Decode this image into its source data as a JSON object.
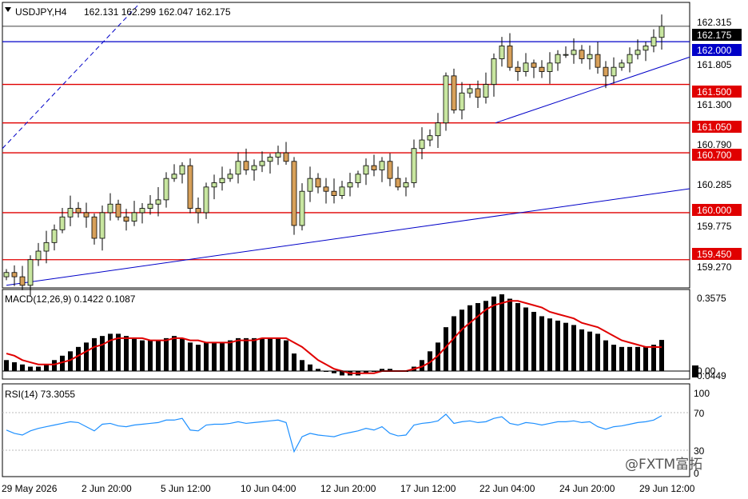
{
  "header": {
    "symbol": "USDJPY,H4",
    "ohlc": "162.131 162.299 162.047 162.175"
  },
  "colors": {
    "background": "#ffffff",
    "bull_body": "#c8e6a0",
    "bear_body": "#d7a05a",
    "wick": "#000000",
    "level_line": "#e00000",
    "level_tag": "#e00000",
    "trend_line": "#0000c8",
    "current_tag": "#000000",
    "macd_hist": "#000000",
    "macd_signal": "#e00000",
    "rsi_line": "#1e90ff"
  },
  "price_axis": {
    "ticks": [
      "162.315",
      "161.805",
      "161.300",
      "160.790",
      "160.285",
      "159.775",
      "159.270"
    ]
  },
  "level_tags": {
    "current": "162.175",
    "blue": "162.000",
    "r1": "161.500",
    "r2": "161.050",
    "r3": "160.700",
    "r4": "160.000",
    "r5": "159.450"
  },
  "macd": {
    "label": "MACD(12,26,9) 0.1422 0.1087",
    "scale_top": "0.3575",
    "scale_zero": "0.00",
    "scale_bottom": "-0.0449"
  },
  "rsi": {
    "label": "RSI(14) 73.3055",
    "levels": [
      "100",
      "70",
      "30",
      "0"
    ]
  },
  "time_axis": {
    "labels": [
      "29 May 2026",
      "2 Jun 20:00",
      "5 Jun 12:00",
      "10 Jun 04:00",
      "12 Jun 20:00",
      "17 Jun 12:00",
      "22 Jun 04:00",
      "24 Jun 20:00",
      "29 Jun 12:00"
    ]
  },
  "watermark": "@FXTM富拓",
  "chart_data": [
    {
      "type": "candlestick",
      "title": "USDJPY,H4",
      "ylim": [
        159.12,
        162.45
      ],
      "horizontal_levels": [
        162.0,
        161.5,
        161.05,
        160.7,
        160.0,
        159.45
      ],
      "closes": [
        159.3,
        159.25,
        159.15,
        159.45,
        159.55,
        159.65,
        159.8,
        159.95,
        160.05,
        160.0,
        159.95,
        159.7,
        160.0,
        160.1,
        159.95,
        159.9,
        160.0,
        160.05,
        160.1,
        160.15,
        160.4,
        160.45,
        160.55,
        160.05,
        160.0,
        160.3,
        160.35,
        160.4,
        160.45,
        160.6,
        160.5,
        160.55,
        160.6,
        160.65,
        160.7,
        160.6,
        159.85,
        160.25,
        160.4,
        160.3,
        160.25,
        160.2,
        160.3,
        160.35,
        160.45,
        160.55,
        160.5,
        160.6,
        160.4,
        160.3,
        160.35,
        160.75,
        160.85,
        160.9,
        161.05,
        161.6,
        161.2,
        161.4,
        161.45,
        161.35,
        161.5,
        161.8,
        161.95,
        161.7,
        161.65,
        161.75,
        161.7,
        161.65,
        161.75,
        161.85,
        161.85,
        161.9,
        161.8,
        161.85,
        161.7,
        161.6,
        161.7,
        161.75,
        161.85,
        161.9,
        161.95,
        162.05,
        162.18
      ]
    },
    {
      "type": "bar",
      "title": "MACD(12,26,9) 0.1422 0.1087",
      "series": [
        {
          "name": "MACD",
          "values": [
            0.05,
            0.04,
            0.03,
            0.02,
            0.02,
            0.03,
            0.05,
            0.07,
            0.09,
            0.11,
            0.13,
            0.15,
            0.16,
            0.17,
            0.17,
            0.16,
            0.15,
            0.14,
            0.14,
            0.14,
            0.15,
            0.16,
            0.15,
            0.13,
            0.12,
            0.13,
            0.13,
            0.13,
            0.14,
            0.15,
            0.15,
            0.15,
            0.15,
            0.15,
            0.15,
            0.14,
            0.08,
            0.05,
            0.03,
            0.01,
            0.0,
            -0.01,
            -0.02,
            -0.02,
            -0.02,
            -0.01,
            0.0,
            0.01,
            0.01,
            0.0,
            0.0,
            0.02,
            0.05,
            0.09,
            0.13,
            0.2,
            0.25,
            0.28,
            0.3,
            0.31,
            0.32,
            0.34,
            0.35,
            0.33,
            0.31,
            0.29,
            0.27,
            0.25,
            0.24,
            0.23,
            0.22,
            0.21,
            0.19,
            0.18,
            0.17,
            0.14,
            0.12,
            0.11,
            0.11,
            0.11,
            0.11,
            0.12,
            0.142
          ]
        },
        {
          "name": "Signal",
          "values": [
            0.08,
            0.07,
            0.05,
            0.04,
            0.03,
            0.03,
            0.03,
            0.04,
            0.05,
            0.07,
            0.09,
            0.11,
            0.12,
            0.14,
            0.15,
            0.15,
            0.15,
            0.15,
            0.14,
            0.14,
            0.14,
            0.15,
            0.15,
            0.14,
            0.14,
            0.13,
            0.13,
            0.13,
            0.13,
            0.14,
            0.14,
            0.14,
            0.15,
            0.15,
            0.15,
            0.15,
            0.13,
            0.11,
            0.08,
            0.05,
            0.03,
            0.01,
            0.0,
            -0.01,
            -0.01,
            -0.01,
            -0.01,
            0.0,
            0.0,
            0.0,
            0.0,
            0.01,
            0.02,
            0.04,
            0.07,
            0.11,
            0.15,
            0.19,
            0.22,
            0.25,
            0.28,
            0.3,
            0.31,
            0.32,
            0.32,
            0.31,
            0.3,
            0.29,
            0.27,
            0.26,
            0.25,
            0.24,
            0.22,
            0.21,
            0.2,
            0.18,
            0.16,
            0.14,
            0.13,
            0.12,
            0.11,
            0.11,
            0.109
          ]
        }
      ]
    },
    {
      "type": "line",
      "title": "RSI(14) 73.3055",
      "ylim": [
        0,
        100
      ],
      "values": [
        56,
        52,
        50,
        55,
        58,
        60,
        62,
        64,
        66,
        65,
        60,
        55,
        63,
        64,
        61,
        60,
        62,
        63,
        64,
        65,
        68,
        68,
        70,
        56,
        55,
        62,
        63,
        63,
        64,
        66,
        64,
        65,
        66,
        67,
        68,
        65,
        30,
        48,
        52,
        50,
        49,
        48,
        51,
        53,
        55,
        58,
        56,
        60,
        52,
        49,
        50,
        62,
        64,
        65,
        67,
        75,
        64,
        66,
        67,
        65,
        66,
        70,
        72,
        64,
        62,
        65,
        64,
        62,
        64,
        66,
        66,
        67,
        65,
        66,
        60,
        57,
        60,
        61,
        63,
        65,
        66,
        68,
        73.3
      ]
    }
  ]
}
